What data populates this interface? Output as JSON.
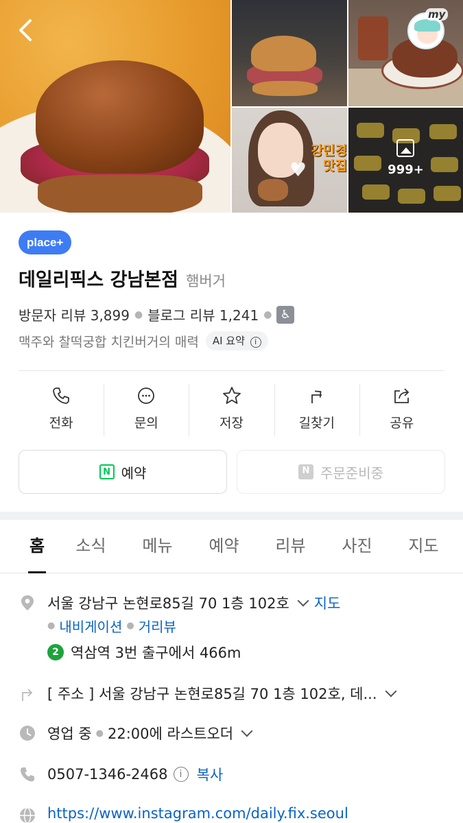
{
  "photos": {
    "main_alt": "burger-photo",
    "caption_overlay": "강민경\n맛집",
    "more_count": "999+",
    "profile_label": "my"
  },
  "place": {
    "badge": "place+",
    "name": "데일리픽스 강남본점",
    "category": "햄버거",
    "visitor_reviews_label": "방문자 리뷰 3,899",
    "blog_reviews_label": "블로그 리뷰 1,241",
    "ai_summary_text": "맥주와 찰떡궁합 치킨버거의 매력",
    "ai_summary_chip": "AI 요약"
  },
  "actions": [
    {
      "label": "전화",
      "icon": "phone-icon"
    },
    {
      "label": "문의",
      "icon": "chat-icon"
    },
    {
      "label": "저장",
      "icon": "star-icon"
    },
    {
      "label": "길찾기",
      "icon": "directions-icon"
    },
    {
      "label": "공유",
      "icon": "share-icon"
    }
  ],
  "buttons": {
    "reserve": "예약",
    "order": "주문준비중"
  },
  "tabs": [
    "홈",
    "소식",
    "메뉴",
    "예약",
    "리뷰",
    "사진",
    "지도"
  ],
  "details": {
    "address": "서울 강남구 논현로85길 70 1층 102호",
    "map_link": "지도",
    "navigation_link": "내비게이션",
    "street_view_link": "거리뷰",
    "subway_line": "2",
    "subway_text": "역삼역 3번 출구에서 466m",
    "address_detail": "[ 주소 ] 서울 강남구 논현로85길 70 1층 102호, 데...",
    "hours_status": "영업 중",
    "hours_text": "22:00에 라스트오더",
    "phone": "0507-1346-2468",
    "copy_link": "복사",
    "website": "https://www.instagram.com/daily.fix.seoul"
  },
  "colors": {
    "badge": "#3d7cf3",
    "link": "#0a63c7",
    "naver_green": "#03c75a",
    "subway_line2": "#1ca43c"
  }
}
